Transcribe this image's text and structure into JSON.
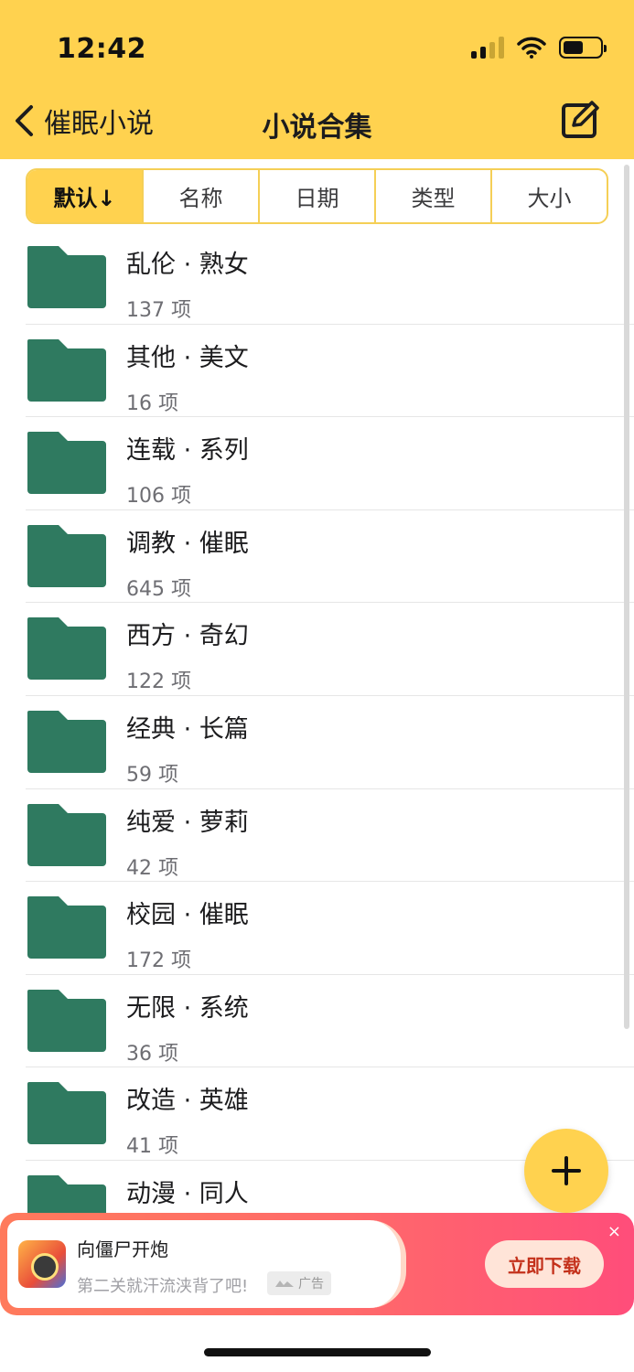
{
  "status_bar": {
    "time": "12:42"
  },
  "nav": {
    "back_label": "催眠小说",
    "title": "小说合集"
  },
  "sort_tabs": [
    {
      "label": "默认↓",
      "active": true
    },
    {
      "label": "名称",
      "active": false
    },
    {
      "label": "日期",
      "active": false
    },
    {
      "label": "类型",
      "active": false
    },
    {
      "label": "大小",
      "active": false
    }
  ],
  "folders": [
    {
      "title": "乱伦 · 熟女",
      "count": "137 项"
    },
    {
      "title": "其他 · 美文",
      "count": "16 项"
    },
    {
      "title": "连载 · 系列",
      "count": "106 项"
    },
    {
      "title": "调教 · 催眠",
      "count": "645 项"
    },
    {
      "title": "西方 · 奇幻",
      "count": "122 项"
    },
    {
      "title": "经典 · 长篇",
      "count": "59 项"
    },
    {
      "title": "纯爱 · 萝莉",
      "count": "42 项"
    },
    {
      "title": "校园 · 催眠",
      "count": "172 项"
    },
    {
      "title": "无限 · 系统",
      "count": "36 项"
    },
    {
      "title": "改造 · 英雄",
      "count": "41 项"
    },
    {
      "title": "动漫 · 同人",
      "count": ""
    }
  ],
  "ad": {
    "title": "向僵尸开炮",
    "subtitle": "第二关就汗流浃背了吧!",
    "tag": "广告",
    "button": "立即下载",
    "close": "×"
  },
  "colors": {
    "accent": "#ffd24f",
    "folder": "#2f7a60",
    "ad_gradient_start": "#ff7a5c",
    "ad_gradient_end": "#ff4d7a"
  }
}
